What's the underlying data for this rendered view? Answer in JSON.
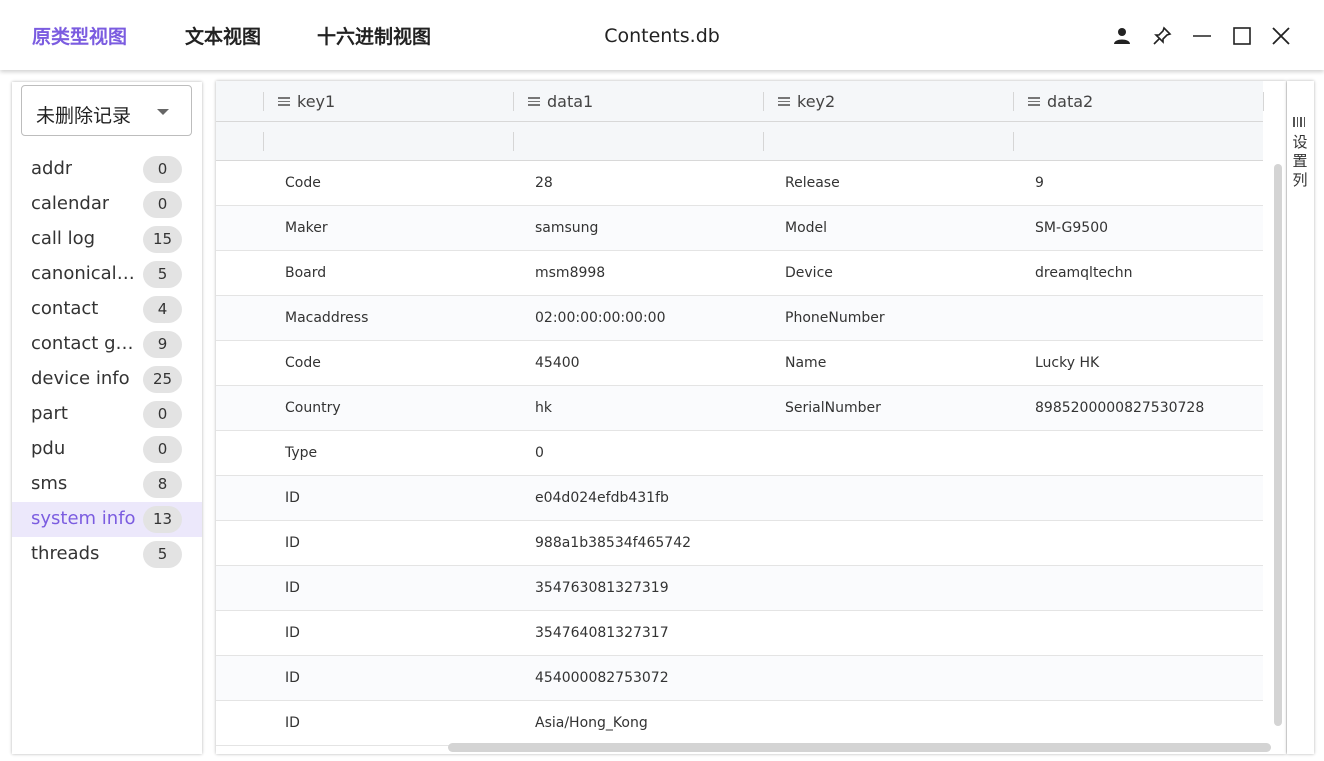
{
  "header": {
    "tabs": [
      {
        "label": "原类型视图",
        "active": true
      },
      {
        "label": "文本视图",
        "active": false
      },
      {
        "label": "十六进制视图",
        "active": false
      }
    ],
    "title": "Contents.db"
  },
  "sidebar": {
    "filter_value": "未删除记录",
    "tables": [
      {
        "name": "addr",
        "count": "0"
      },
      {
        "name": "calendar",
        "count": "0"
      },
      {
        "name": "call log",
        "count": "15"
      },
      {
        "name": "canonical ...",
        "count": "5"
      },
      {
        "name": "contact",
        "count": "4"
      },
      {
        "name": "contact gr...",
        "count": "9"
      },
      {
        "name": "device info",
        "count": "25"
      },
      {
        "name": "part",
        "count": "0"
      },
      {
        "name": "pdu",
        "count": "0"
      },
      {
        "name": "sms",
        "count": "8"
      },
      {
        "name": "system info",
        "count": "13",
        "selected": true
      },
      {
        "name": "threads",
        "count": "5"
      }
    ]
  },
  "grid": {
    "columns": [
      "key1",
      "data1",
      "key2",
      "data2"
    ],
    "rows": [
      [
        "Code",
        "28",
        "Release",
        "9"
      ],
      [
        "Maker",
        "samsung",
        "Model",
        "SM-G9500"
      ],
      [
        "Board",
        "msm8998",
        "Device",
        "dreamqltechn"
      ],
      [
        "Macaddress",
        "02:00:00:00:00:00",
        "PhoneNumber",
        ""
      ],
      [
        "Code",
        "45400",
        "Name",
        "Lucky HK"
      ],
      [
        "Country",
        "hk",
        "SerialNumber",
        "89852000008275307​28"
      ],
      [
        "Type",
        "0",
        "",
        ""
      ],
      [
        "ID",
        "e04d024efdb431fb",
        "",
        ""
      ],
      [
        "ID",
        "988a1b38534f465742",
        "",
        ""
      ],
      [
        "ID",
        "354763081327319",
        "",
        ""
      ],
      [
        "ID",
        "354764081327317",
        "",
        ""
      ],
      [
        "ID",
        "454000082753072",
        "",
        ""
      ],
      [
        "ID",
        "Asia/Hong_Kong",
        "",
        ""
      ]
    ]
  },
  "settings": {
    "label": "设置列"
  },
  "colors": {
    "accent": "#7b5ce0",
    "selected_bg": "#ece8fb",
    "badge_bg": "#e3e3e3"
  }
}
